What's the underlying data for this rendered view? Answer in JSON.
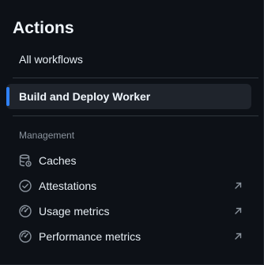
{
  "header": {
    "title": "Actions"
  },
  "nav": {
    "all_workflows": "All workflows",
    "selected_workflow": "Build and Deploy Worker"
  },
  "management": {
    "section_label": "Management",
    "items": [
      {
        "label": "Caches",
        "icon": "database-icon",
        "external": false
      },
      {
        "label": "Attestations",
        "icon": "check-circle-icon",
        "external": true
      },
      {
        "label": "Usage metrics",
        "icon": "meter-icon",
        "external": true
      },
      {
        "label": "Performance metrics",
        "icon": "meter-icon",
        "external": true
      }
    ]
  },
  "colors": {
    "background": "#0d1117",
    "selected_background": "#1f242c",
    "accent": "#2f81f7",
    "muted_text": "#8b949e"
  }
}
